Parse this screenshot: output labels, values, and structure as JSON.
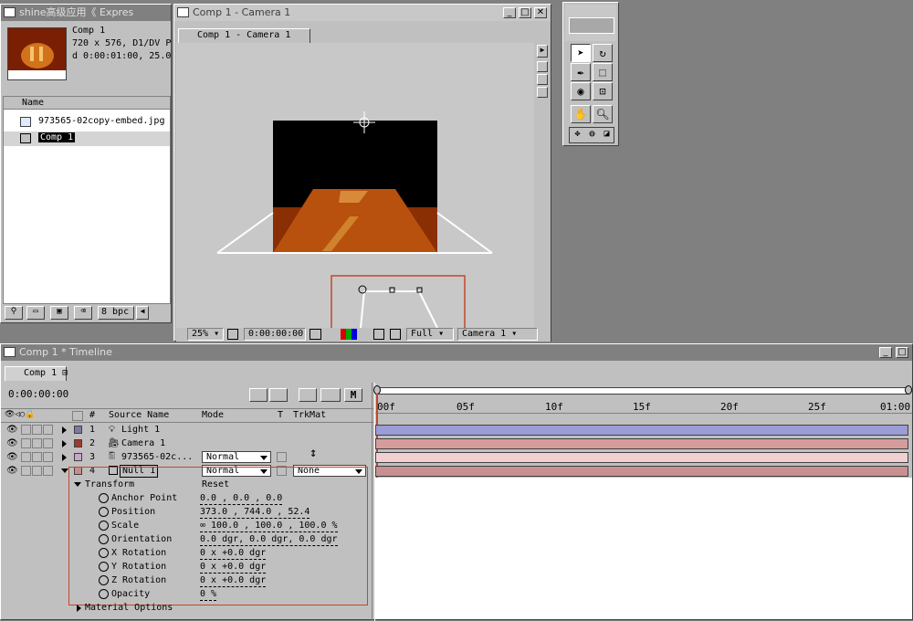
{
  "project": {
    "title": "shine高级应用《 Expres",
    "comp_name": "Comp 1",
    "comp_info1": "720 x 576, D1/DV P",
    "comp_info2": "d 0:00:01:00, 25.0",
    "col_name": "Name",
    "items": [
      "973565-02copy-embed.jpg",
      "Comp 1"
    ],
    "bpc": "8 bpc"
  },
  "viewer": {
    "title": "Comp 1 - Camera 1",
    "tab": "Comp 1 - Camera 1",
    "zoom": "25%",
    "timecode": "0:00:00:00",
    "resolution": "Full",
    "view": "Camera 1"
  },
  "timeline": {
    "title": "Comp 1 * Timeline",
    "tab": "Comp 1",
    "timecode": "0:00:00:00",
    "col_num": "#",
    "col_source": "Source Name",
    "col_mode": "Mode",
    "col_t": "T",
    "col_trkmat": "TrkMat",
    "ruler": [
      "00f",
      "05f",
      "10f",
      "15f",
      "20f",
      "25f",
      "01:00"
    ],
    "layers": [
      {
        "num": "1",
        "name": "Light 1",
        "color": "#7b7b9c",
        "bar": "#9c9cd6"
      },
      {
        "num": "2",
        "name": "Camera 1",
        "color": "#a03a2a",
        "bar": "#d69c9c"
      },
      {
        "num": "3",
        "name": "973565-02c...",
        "mode": "Normal",
        "color": "#c8a6c8",
        "bar": "#f0d0d0"
      },
      {
        "num": "4",
        "name": "Null 1",
        "mode": "Normal",
        "trkmat": "None",
        "color": "#c88c8c",
        "bar": "#c89090"
      }
    ],
    "transform": {
      "label": "Transform",
      "reset": "Reset",
      "props": [
        {
          "name": "Anchor Point",
          "value": "0.0 , 0.0 , 0.0"
        },
        {
          "name": "Position",
          "value": "373.0 , 744.0 , 52.4"
        },
        {
          "name": "Scale",
          "value": "∞ 100.0 , 100.0 , 100.0 %"
        },
        {
          "name": "Orientation",
          "value": "0.0 dgr, 0.0 dgr, 0.0 dgr"
        },
        {
          "name": "X Rotation",
          "value": "0 x +0.0 dgr"
        },
        {
          "name": "Y Rotation",
          "value": "0 x +0.0 dgr"
        },
        {
          "name": "Z Rotation",
          "value": "0 x +0.0 dgr"
        },
        {
          "name": "Opacity",
          "value": "0 %"
        }
      ],
      "material": "Material Options"
    }
  }
}
